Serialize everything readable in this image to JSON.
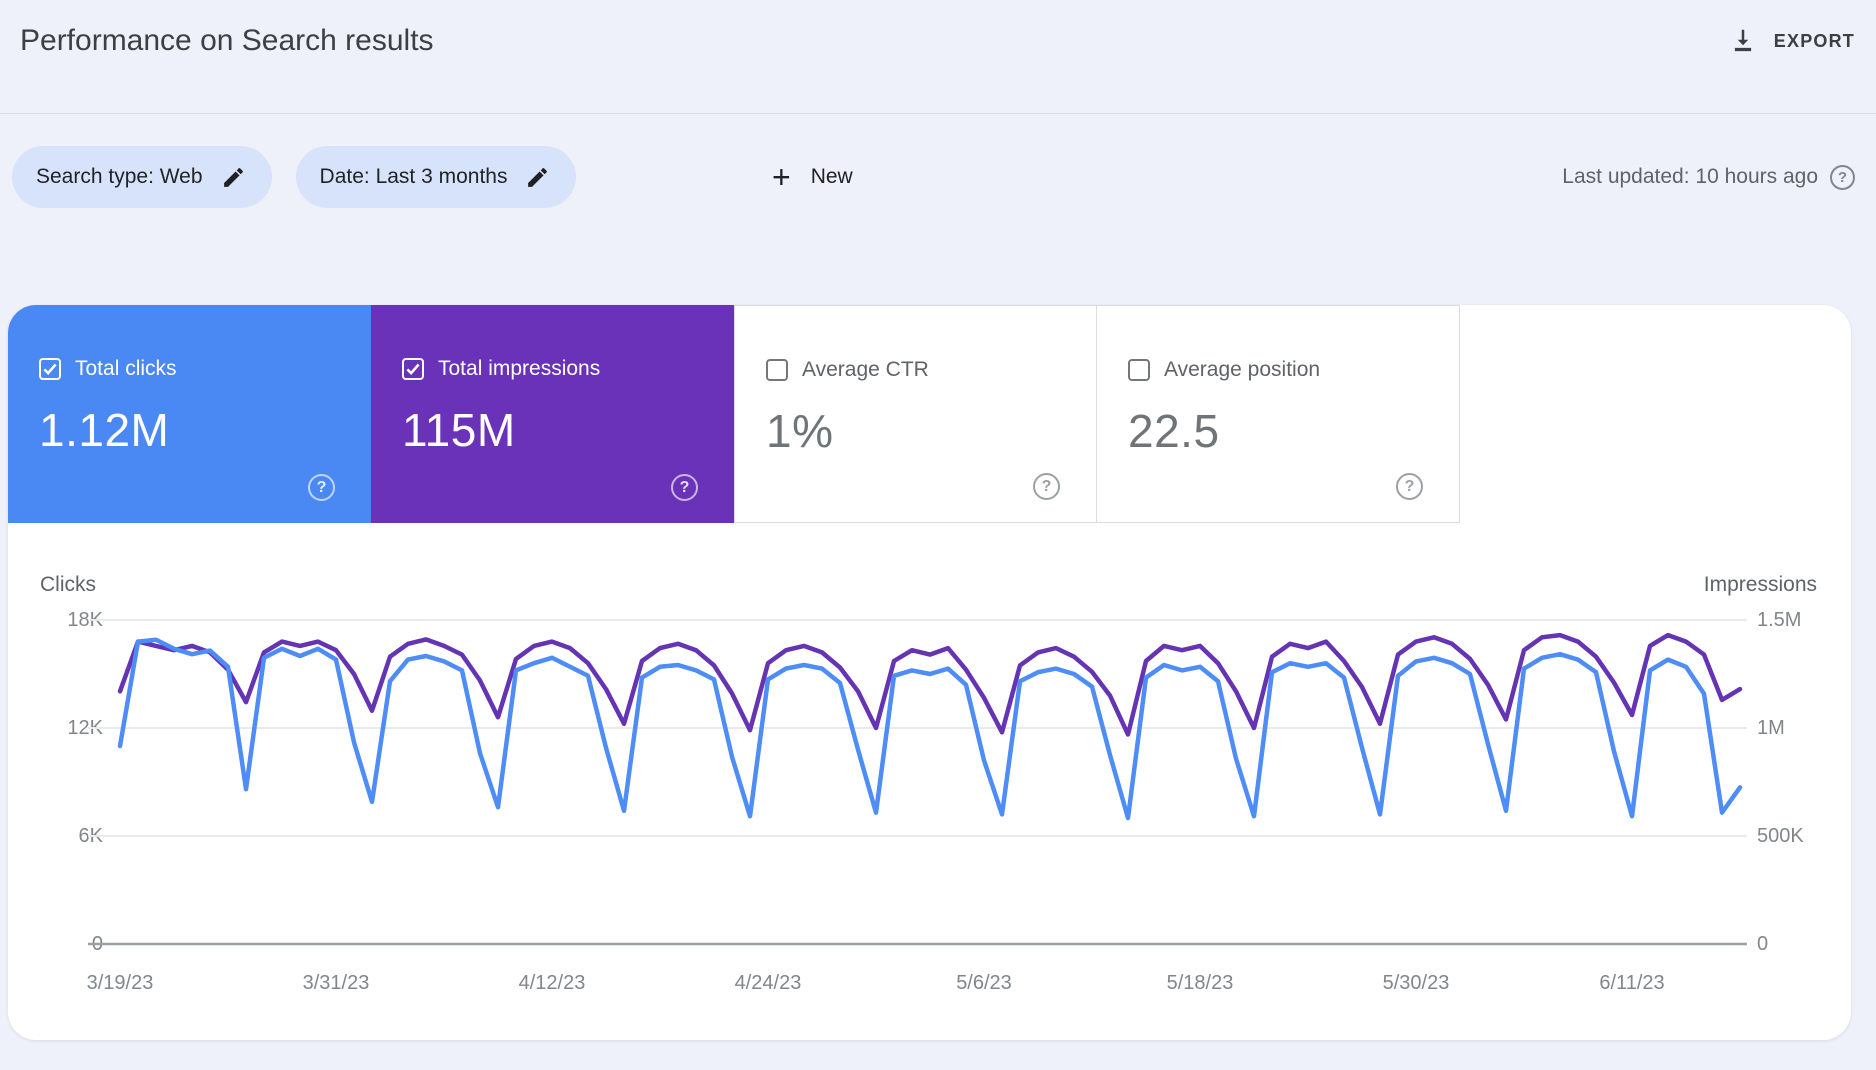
{
  "header": {
    "title": "Performance on Search results",
    "export_label": "EXPORT"
  },
  "filters": {
    "search_type_chip": "Search type: Web",
    "date_chip": "Date: Last 3 months",
    "new_label": "New",
    "last_updated": "Last updated: 10 hours ago",
    "help_glyph": "?"
  },
  "metrics": [
    {
      "label": "Total clicks",
      "value": "1.12M",
      "checked": true,
      "bg": "#4a88f4"
    },
    {
      "label": "Total impressions",
      "value": "115M",
      "checked": true,
      "bg": "#6a32b8"
    },
    {
      "label": "Average CTR",
      "value": "1%",
      "checked": false,
      "bg": "#ffffff"
    },
    {
      "label": "Average position",
      "value": "22.5",
      "checked": false,
      "bg": "#ffffff"
    }
  ],
  "icons": {
    "download-icon": "arrow-down-with-bar",
    "edit-pencil-icon": "pencil",
    "plus-icon": "+",
    "help-icon": "?",
    "checkbox-checked": "white box with check",
    "checkbox-unchecked": "gray outline box"
  },
  "colors": {
    "page_bg": "#eef1fa",
    "card_bg": "#ffffff",
    "clicks_accent": "#4a88f4",
    "impressions_accent": "#6a32b8",
    "clicks_line": "#4e8df5",
    "impressions_line": "#6434b2",
    "chip_bg": "#d7e3fb",
    "grid_line": "#e8eaed",
    "axis_line": "#9aa0a6",
    "tick_text": "#80868b"
  },
  "chart_data": {
    "type": "line",
    "title": "Clicks and Impressions over last 3 months (daily)",
    "left_axis": {
      "label": "Clicks",
      "ticks": [
        "18K",
        "12K",
        "6K",
        "0"
      ],
      "max": 18000,
      "gridstep": 6000
    },
    "right_axis": {
      "label": "Impressions",
      "ticks": [
        "1.5M",
        "1M",
        "500K",
        "0"
      ],
      "max": 1500000,
      "gridstep": 500000
    },
    "x_labels": [
      "3/19/23",
      "3/31/23",
      "4/12/23",
      "4/24/23",
      "5/6/23",
      "5/18/23",
      "5/30/23",
      "6/11/23"
    ],
    "x_label_indices": [
      0,
      12,
      24,
      36,
      48,
      60,
      72,
      84
    ],
    "grid": true,
    "legend_position": "none",
    "series": [
      {
        "name": "Total impressions",
        "axis": "right",
        "color": "#6434b2",
        "values": [
          1170000,
          1400000,
          1380000,
          1360000,
          1380000,
          1350000,
          1270000,
          1120000,
          1350000,
          1400000,
          1380000,
          1400000,
          1360000,
          1250000,
          1080000,
          1330000,
          1390000,
          1410000,
          1380000,
          1340000,
          1220000,
          1050000,
          1320000,
          1380000,
          1400000,
          1370000,
          1300000,
          1180000,
          1020000,
          1310000,
          1370000,
          1390000,
          1360000,
          1290000,
          1160000,
          990000,
          1300000,
          1360000,
          1380000,
          1350000,
          1280000,
          1170000,
          1000000,
          1310000,
          1360000,
          1340000,
          1370000,
          1270000,
          1140000,
          980000,
          1290000,
          1350000,
          1370000,
          1330000,
          1260000,
          1150000,
          970000,
          1310000,
          1380000,
          1360000,
          1380000,
          1300000,
          1170000,
          1000000,
          1330000,
          1390000,
          1370000,
          1400000,
          1310000,
          1190000,
          1020000,
          1340000,
          1400000,
          1420000,
          1390000,
          1320000,
          1200000,
          1040000,
          1360000,
          1420000,
          1430000,
          1400000,
          1330000,
          1210000,
          1060000,
          1380000,
          1430000,
          1400000,
          1340000,
          1130000,
          1180000
        ]
      },
      {
        "name": "Total clicks",
        "axis": "left",
        "color": "#4e8df5",
        "values": [
          11000,
          16800,
          16900,
          16400,
          16100,
          16300,
          15400,
          8600,
          15900,
          16400,
          16000,
          16400,
          15800,
          11200,
          7900,
          14600,
          15800,
          16000,
          15700,
          15200,
          10600,
          7600,
          15200,
          15600,
          15900,
          15400,
          14900,
          10900,
          7400,
          14800,
          15400,
          15500,
          15200,
          14700,
          10400,
          7100,
          14700,
          15300,
          15500,
          15300,
          14500,
          10800,
          7300,
          14900,
          15200,
          15000,
          15300,
          14400,
          10200,
          7200,
          14600,
          15100,
          15300,
          15000,
          14300,
          10500,
          7000,
          14800,
          15500,
          15200,
          15400,
          14600,
          10300,
          7100,
          15100,
          15600,
          15400,
          15600,
          14800,
          10900,
          7200,
          14900,
          15700,
          15900,
          15600,
          15000,
          11100,
          7400,
          15300,
          15900,
          16100,
          15800,
          15100,
          10700,
          7100,
          15200,
          15800,
          15400,
          13900,
          7300,
          8700
        ]
      }
    ]
  }
}
